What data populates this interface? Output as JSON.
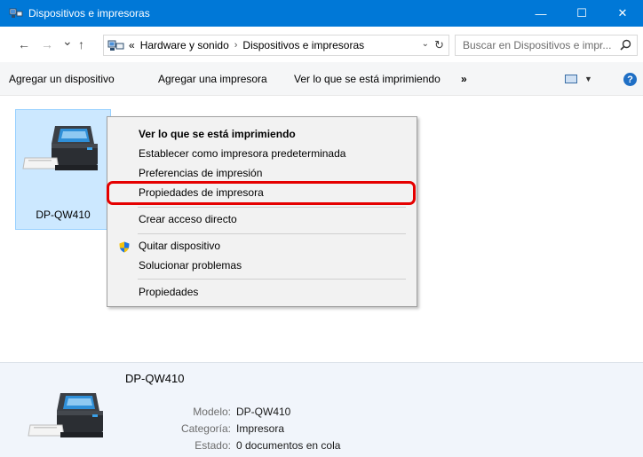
{
  "window": {
    "title": "Dispositivos e impresoras",
    "minimize_glyph": "—",
    "maximize_glyph": "☐",
    "close_glyph": "✕"
  },
  "address_bar": {
    "back_glyph": "←",
    "forward_glyph": "→",
    "recent_glyph": "⌄",
    "up_glyph": "↑",
    "overflow": "«",
    "breadcrumb": [
      "Hardware y sonido",
      "Dispositivos e impresoras"
    ],
    "separator": "›",
    "dropdown_glyph": "⌄",
    "refresh_glyph": "↻",
    "search_placeholder": "Buscar en Dispositivos e impr..."
  },
  "command_bar": {
    "items": [
      "Agregar un dispositivo",
      "Agregar una impresora",
      "Ver lo que se está imprimiendo"
    ],
    "more": "»",
    "view_dropdown_glyph": "▼",
    "help_glyph": "?"
  },
  "device": {
    "name": "DP-QW410"
  },
  "context_menu": {
    "items": [
      "Ver lo que se está imprimiendo",
      "Establecer como impresora predeterminada",
      "Preferencias de impresión",
      "Propiedades de impresora",
      "Crear acceso directo",
      "Quitar dispositivo",
      "Solucionar problemas",
      "Propiedades"
    ]
  },
  "details": {
    "name": "DP-QW410",
    "properties": [
      {
        "key": "Modelo:",
        "value": "DP-QW410"
      },
      {
        "key": "Categoría:",
        "value": "Impresora"
      },
      {
        "key": "Estado:",
        "value": "0 documentos en cola"
      }
    ]
  },
  "colors": {
    "titlebar": "#0078d7",
    "selection": "#cce8ff",
    "highlight_outline": "#e50000",
    "details_bg": "#f1f5fb"
  }
}
